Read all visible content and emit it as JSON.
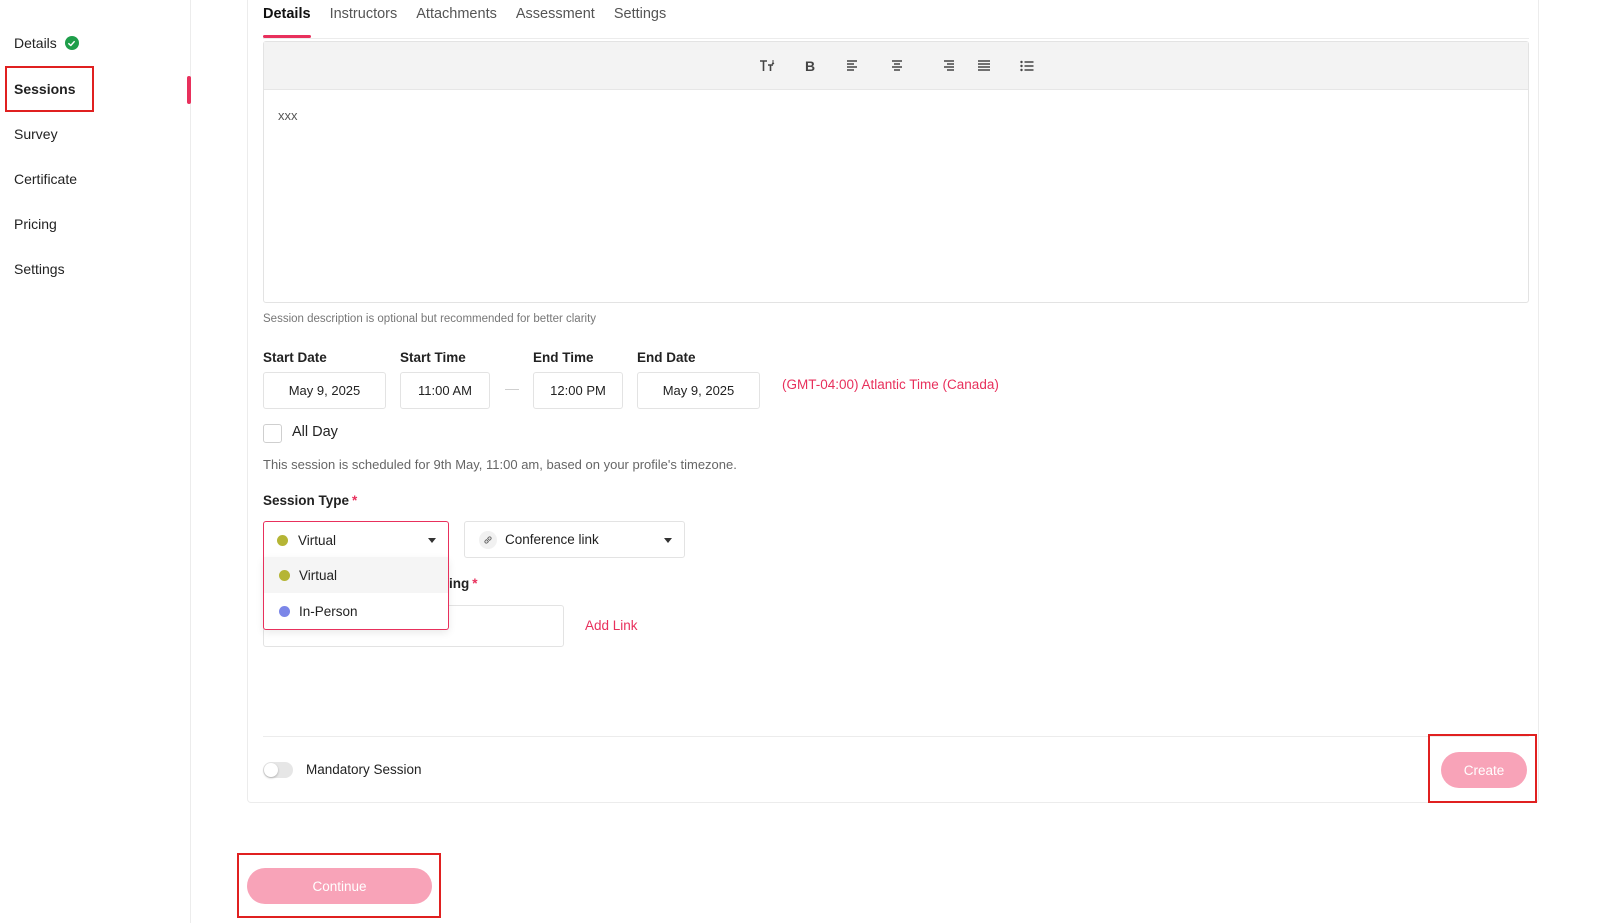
{
  "sidebar": {
    "items": [
      {
        "label": "Details",
        "completed": true
      },
      {
        "label": "Sessions",
        "active": true
      },
      {
        "label": "Survey"
      },
      {
        "label": "Certificate"
      },
      {
        "label": "Pricing"
      },
      {
        "label": "Settings"
      }
    ]
  },
  "tabs": [
    {
      "label": "Details",
      "active": true
    },
    {
      "label": "Instructors"
    },
    {
      "label": "Attachments"
    },
    {
      "label": "Assessment"
    },
    {
      "label": "Settings"
    }
  ],
  "editor": {
    "toolbar": [
      "text-size-icon",
      "bold-icon",
      "align-left-icon",
      "align-center-icon",
      "align-right-icon",
      "align-justify-icon",
      "bullet-list-icon"
    ],
    "bold_glyph": "B",
    "content": "xxx"
  },
  "hint": "Session description is optional but recommended for better clarity",
  "dates": {
    "start_date_label": "Start Date",
    "start_date": "May 9, 2025",
    "start_time_label": "Start Time",
    "start_time": "11:00 AM",
    "end_time_label": "End Time",
    "end_time": "12:00 PM",
    "end_date_label": "End Date",
    "end_date": "May 9, 2025",
    "timezone": "(GMT-04:00) Atlantic Time (Canada)"
  },
  "all_day": {
    "label": "All Day",
    "checked": false
  },
  "schedule_note": "This session is scheduled for 9th May, 11:00 am, based on your profile's timezone.",
  "session_type": {
    "label": "Session Type",
    "required_mark": "*",
    "selected": "Virtual",
    "selected_color": "#b5b535",
    "options": [
      {
        "label": "Virtual",
        "color": "#b5b535"
      },
      {
        "label": "In-Person",
        "color": "#7b86e8"
      }
    ]
  },
  "conference": {
    "selected": "Conference link"
  },
  "meeting": {
    "label_partial": "ing",
    "required_mark": "*",
    "add_link": "Add Link"
  },
  "mandatory": {
    "label": "Mandatory Session",
    "on": false
  },
  "buttons": {
    "create": "Create",
    "continue": "Continue"
  },
  "colors": {
    "accent": "#e8305c",
    "button_disabled": "#f8a3b8",
    "success": "#1e9e4a"
  }
}
